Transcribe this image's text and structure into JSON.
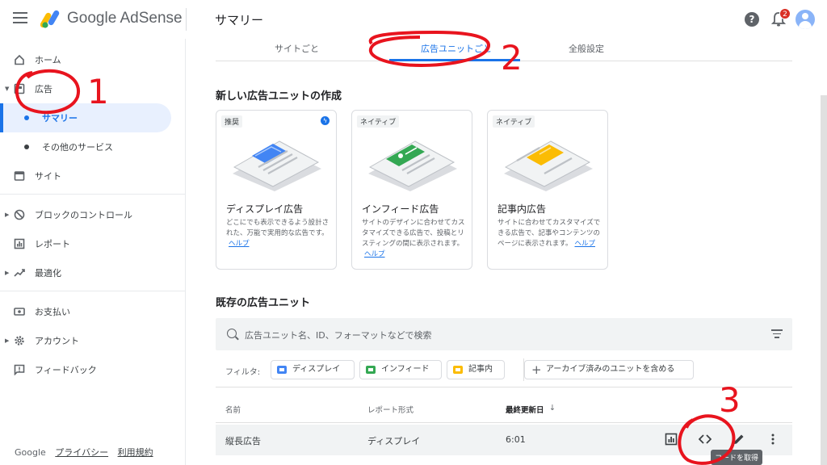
{
  "header": {
    "brand": "Google AdSense",
    "title": "サマリー",
    "notification_count": "2",
    "help_glyph": "?"
  },
  "sidebar": {
    "items": [
      {
        "label": "ホーム",
        "icon": "home-icon"
      },
      {
        "label": "広告",
        "icon": "ads-icon"
      },
      {
        "label": "サマリー"
      },
      {
        "label": "その他のサービス"
      },
      {
        "label": "サイト",
        "icon": "site-icon"
      },
      {
        "label": "ブロックのコントロール",
        "icon": "block-icon"
      },
      {
        "label": "レポート",
        "icon": "report-icon"
      },
      {
        "label": "最適化",
        "icon": "optimize-icon"
      },
      {
        "label": "お支払い",
        "icon": "payment-icon"
      },
      {
        "label": "アカウント",
        "icon": "gear-icon"
      },
      {
        "label": "フィードバック",
        "icon": "feedback-icon"
      }
    ],
    "footer": {
      "brand": "Google",
      "privacy": "プライバシー",
      "terms": "利用規約"
    }
  },
  "tabs": [
    {
      "label": "サイトごと"
    },
    {
      "label": "広告ユニットごと",
      "active": true
    },
    {
      "label": "全般設定"
    }
  ],
  "create_section": {
    "title": "新しい広告ユニットの作成",
    "cards": [
      {
        "tag": "推奨",
        "title": "ディスプレイ広告",
        "desc": "どこにでも表示できるよう設計された、万能で実用的な広告です。",
        "help": "ヘルプ",
        "color": "#4285f4"
      },
      {
        "tag": "ネイティブ",
        "title": "インフィード広告",
        "desc": "サイトのデザインに合わせてカスタマイズできる広告で、投稿とリスティングの間に表示されます。",
        "help": "ヘルプ",
        "color": "#34a853"
      },
      {
        "tag": "ネイティブ",
        "title": "記事内広告",
        "desc": "サイトに合わせてカスタマイズできる広告で、記事やコンテンツのページに表示されます。",
        "help": "ヘルプ",
        "color": "#fbbc04"
      }
    ]
  },
  "existing_section": {
    "title": "既存の広告ユニット",
    "search_placeholder": "広告ユニット名、ID、フォーマットなどで検索",
    "filter_label": "フィルタ:",
    "chips": [
      {
        "label": "ディスプレイ",
        "color": "#4285f4"
      },
      {
        "label": "インフィード",
        "color": "#34a853"
      },
      {
        "label": "記事内",
        "color": "#fbbc04"
      },
      {
        "label": "アーカイブ済みのユニットを含める"
      }
    ],
    "columns": [
      "名前",
      "レポート形式",
      "最終更新日"
    ],
    "sort_arrow": "↓",
    "rows": [
      {
        "name": "縦長広告",
        "format": "ディスプレイ",
        "updated": "6:01"
      }
    ],
    "tooltip": "コードを取得"
  },
  "annotations": {
    "one": "1",
    "two": "2",
    "three": "3",
    "color": "#e8141e"
  }
}
